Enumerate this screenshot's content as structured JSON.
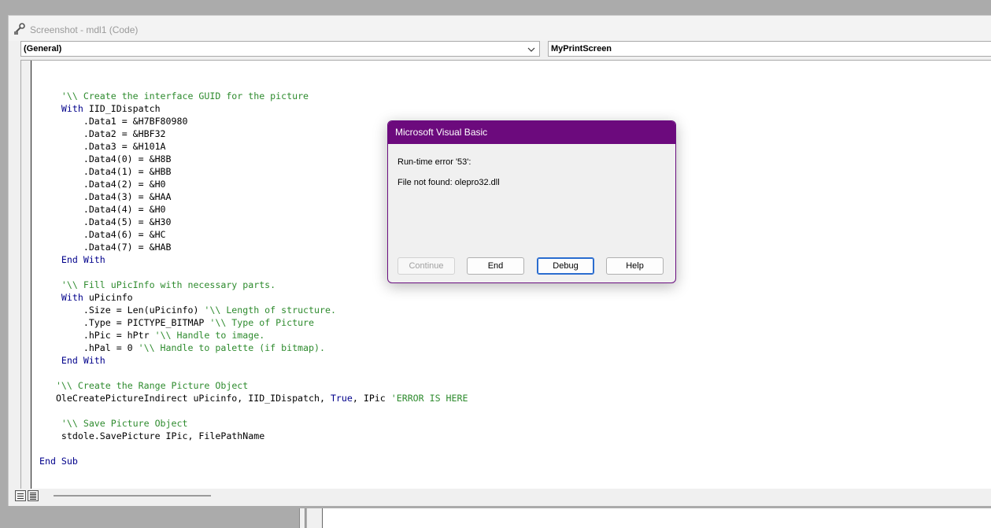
{
  "window": {
    "title": "Screenshot - mdl1 (Code)",
    "object_combo": "(General)",
    "procedure_combo": "MyPrintScreen"
  },
  "code_lines": [
    [],
    [
      {
        "t": "    "
      },
      {
        "t": "'\\\\ Create the interface GUID for the picture",
        "c": "cm"
      }
    ],
    [
      {
        "t": "    "
      },
      {
        "t": "With",
        "c": "kw"
      },
      {
        "t": " IID_IDispatch"
      }
    ],
    [
      {
        "t": "        .Data1 = &H7BF80980"
      }
    ],
    [
      {
        "t": "        .Data2 = &HBF32"
      }
    ],
    [
      {
        "t": "        .Data3 = &H101A"
      }
    ],
    [
      {
        "t": "        .Data4(0) = &H8B"
      }
    ],
    [
      {
        "t": "        .Data4(1) = &HBB"
      }
    ],
    [
      {
        "t": "        .Data4(2) = &H0"
      }
    ],
    [
      {
        "t": "        .Data4(3) = &HAA"
      }
    ],
    [
      {
        "t": "        .Data4(4) = &H0"
      }
    ],
    [
      {
        "t": "        .Data4(5) = &H30"
      }
    ],
    [
      {
        "t": "        .Data4(6) = &HC"
      }
    ],
    [
      {
        "t": "        .Data4(7) = &HAB"
      }
    ],
    [
      {
        "t": "    "
      },
      {
        "t": "End With",
        "c": "kw"
      }
    ],
    [],
    [
      {
        "t": "    "
      },
      {
        "t": "'\\\\ Fill uPicInfo with necessary parts.",
        "c": "cm"
      }
    ],
    [
      {
        "t": "    "
      },
      {
        "t": "With",
        "c": "kw"
      },
      {
        "t": " uPicinfo"
      }
    ],
    [
      {
        "t": "        .Size = Len(uPicinfo) "
      },
      {
        "t": "'\\\\ Length of structure.",
        "c": "cm"
      }
    ],
    [
      {
        "t": "        .Type = PICTYPE_BITMAP "
      },
      {
        "t": "'\\\\ Type of Picture",
        "c": "cm"
      }
    ],
    [
      {
        "t": "        .hPic = hPtr "
      },
      {
        "t": "'\\\\ Handle to image.",
        "c": "cm"
      }
    ],
    [
      {
        "t": "        .hPal = 0 "
      },
      {
        "t": "'\\\\ Handle to palette (if bitmap).",
        "c": "cm"
      }
    ],
    [
      {
        "t": "    "
      },
      {
        "t": "End With",
        "c": "kw"
      }
    ],
    [],
    [
      {
        "t": "   "
      },
      {
        "t": "'\\\\ Create the Range Picture Object",
        "c": "cm"
      }
    ],
    [
      {
        "t": "   OleCreatePictureIndirect uPicinfo, IID_IDispatch, "
      },
      {
        "t": "True",
        "c": "kw"
      },
      {
        "t": ", IPic "
      },
      {
        "t": "'ERROR IS HERE",
        "c": "cm"
      }
    ],
    [],
    [
      {
        "t": "    "
      },
      {
        "t": "'\\\\ Save Picture Object",
        "c": "cm"
      }
    ],
    [
      {
        "t": "    stdole.SavePicture IPic, FilePathName"
      }
    ],
    [],
    [
      {
        "t": "End Sub",
        "c": "kw"
      }
    ]
  ],
  "dialog": {
    "title": "Microsoft Visual Basic",
    "error_line": "Run-time error '53':",
    "message": "File not found: olepro32.dll",
    "buttons": {
      "continue": "Continue",
      "end": "End",
      "debug": "Debug",
      "help": "Help"
    }
  },
  "colors": {
    "dialog_title_bar": "#6c0a7d",
    "keyword": "#00008b",
    "comment": "#2e8b2e"
  },
  "icons": {
    "app": "vba-editor-icon",
    "combo": "chevron-down-icon",
    "view_procedure": "procedure-view-icon",
    "view_module": "full-module-view-icon"
  }
}
